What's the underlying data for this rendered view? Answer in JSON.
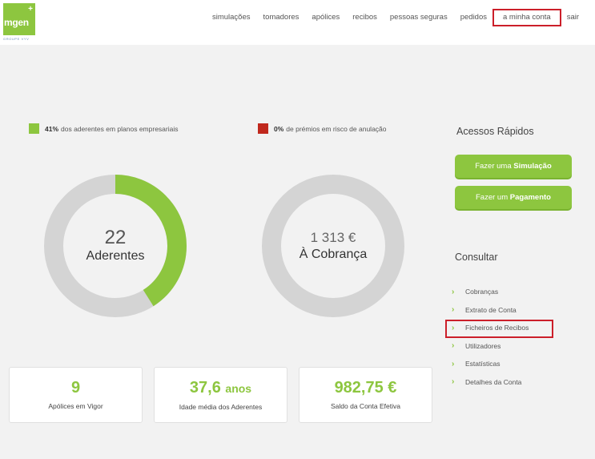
{
  "header": {
    "logo_text": "mgen",
    "logo_plus": "+",
    "logo_group": "GROUPE VYV",
    "nav": [
      "simulações",
      "tomadores",
      "apólices",
      "recibos",
      "pessoas seguras",
      "pedidos",
      "a minha conta",
      "sair"
    ]
  },
  "stats": {
    "legend1": {
      "value": "41%",
      "text": "dos aderentes em planos empresariais",
      "color": "#8dc63f"
    },
    "legend2": {
      "value": "0%",
      "text": "de prémios em risco de anulação",
      "color": "#c0281d"
    },
    "donut1": {
      "number": "22",
      "label": "Aderentes",
      "fraction": 0.41
    },
    "donut2": {
      "amount": "1 313 €",
      "label": "À Cobrança",
      "fraction": 0
    }
  },
  "cards": [
    {
      "value": "9",
      "unit": "",
      "label": "Apólices em Vigor"
    },
    {
      "value": "37,6",
      "unit": "anos",
      "label": "Idade média dos Aderentes"
    },
    {
      "value": "982,75 €",
      "unit": "",
      "label": "Saldo da Conta Efetiva"
    }
  ],
  "sidebar": {
    "quick_title": "Acessos Rápidos",
    "btn_sim_prefix": "Fazer uma ",
    "btn_sim_bold": "Simulação",
    "btn_pay_prefix": "Fazer um ",
    "btn_pay_bold": "Pagamento",
    "consult_title": "Consultar",
    "links": [
      "Cobranças",
      "Extrato de Conta",
      "Ficheiros de Recibos",
      "Utilizadores",
      "Estatísticas",
      "Detalhes da Conta"
    ]
  },
  "colors": {
    "accent": "#8dc63f",
    "danger": "#c0281d",
    "track": "#d4d4d4",
    "highlight": "#cc1f2a"
  }
}
